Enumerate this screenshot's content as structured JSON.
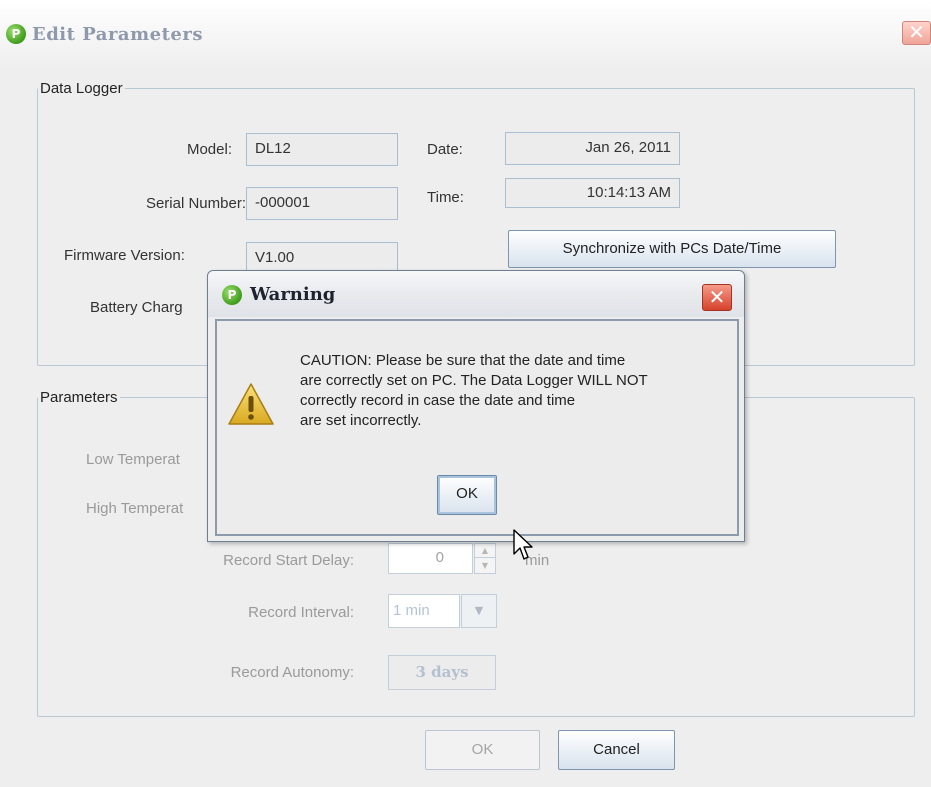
{
  "main_window": {
    "title": "Edit Parameters",
    "close_glyph": "✕",
    "icon": "app-logo-icon",
    "logo_letter": "P"
  },
  "data_logger": {
    "legend": "Data Logger",
    "model_label": "Model:",
    "model_value": "DL12",
    "serial_label": "Serial Number:",
    "serial_value": "-000001",
    "firmware_label": "Firmware Version:",
    "firmware_value": "V1.00",
    "battery_label": "Battery Charg",
    "date_label": "Date:",
    "date_value": "Jan 26, 2011",
    "time_label": "Time:",
    "time_value": "10:14:13 AM",
    "sync_button": "Synchronize with PCs Date/Time"
  },
  "parameters": {
    "legend": "Parameters",
    "low_temp_label": "Low Temperat",
    "high_temp_label": "High Temperat",
    "start_delay_label": "Record Start Delay:",
    "start_delay_value": "0",
    "start_delay_unit": "min",
    "interval_label": "Record Interval:",
    "interval_value": "1 min",
    "autonomy_label": "Record Autonomy:",
    "autonomy_value": "3 days"
  },
  "footer": {
    "ok_label": "OK",
    "cancel_label": "Cancel"
  },
  "warning_dialog": {
    "title": "Warning",
    "close_glyph": "✕",
    "icon": "warning-icon",
    "message_lines": [
      "CAUTION: Please be sure that the date and time",
      "are correctly set on PC. The Data Logger WILL NOT",
      "correctly record in case the date and time",
      "are set incorrectly."
    ],
    "ok_label": "OK"
  },
  "colors": {
    "title_text": "#8e9aab",
    "border": "#a9bed1",
    "close_red": "#d5422c",
    "logo_green": "#3f9c1c",
    "warning_yellow": "#e8c23a"
  }
}
